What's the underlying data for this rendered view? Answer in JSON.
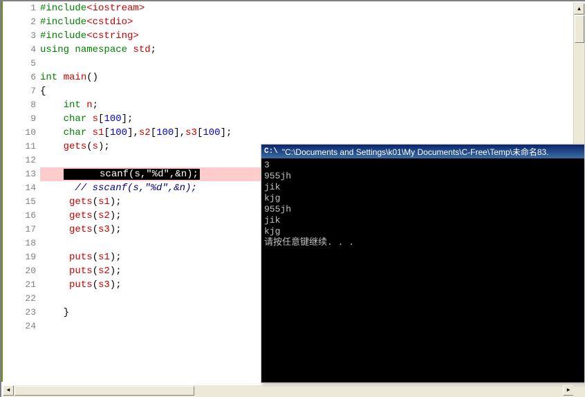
{
  "editor": {
    "lines": [
      {
        "num": "1",
        "segs": [
          {
            "cls": "kw-green",
            "t": "#include"
          },
          {
            "cls": "kw-red",
            "t": "<iostream>"
          }
        ]
      },
      {
        "num": "2",
        "segs": [
          {
            "cls": "kw-green",
            "t": "#include"
          },
          {
            "cls": "kw-red",
            "t": "<cstdio>"
          }
        ]
      },
      {
        "num": "3",
        "segs": [
          {
            "cls": "kw-green",
            "t": "#include"
          },
          {
            "cls": "kw-red",
            "t": "<cstring>"
          }
        ]
      },
      {
        "num": "4",
        "segs": [
          {
            "cls": "kw-green",
            "t": "using"
          },
          {
            "cls": "text-black",
            "t": " "
          },
          {
            "cls": "kw-green",
            "t": "namespace"
          },
          {
            "cls": "text-black",
            "t": " "
          },
          {
            "cls": "kw-red",
            "t": "std"
          },
          {
            "cls": "text-black",
            "t": ";"
          }
        ]
      },
      {
        "num": "5",
        "segs": []
      },
      {
        "num": "6",
        "segs": [
          {
            "cls": "kw-green",
            "t": "int"
          },
          {
            "cls": "text-black",
            "t": " "
          },
          {
            "cls": "kw-red",
            "t": "main"
          },
          {
            "cls": "text-black",
            "t": "()"
          }
        ]
      },
      {
        "num": "7",
        "segs": [
          {
            "cls": "text-black",
            "t": "{"
          }
        ]
      },
      {
        "num": "8",
        "segs": [
          {
            "cls": "text-black",
            "t": "    "
          },
          {
            "cls": "kw-green",
            "t": "int"
          },
          {
            "cls": "text-black",
            "t": " "
          },
          {
            "cls": "kw-red",
            "t": "n"
          },
          {
            "cls": "text-black",
            "t": ";"
          }
        ]
      },
      {
        "num": "9",
        "segs": [
          {
            "cls": "text-black",
            "t": "    "
          },
          {
            "cls": "kw-green",
            "t": "char"
          },
          {
            "cls": "text-black",
            "t": " "
          },
          {
            "cls": "kw-red",
            "t": "s"
          },
          {
            "cls": "text-black",
            "t": "["
          },
          {
            "cls": "lit-blue",
            "t": "100"
          },
          {
            "cls": "text-black",
            "t": "];"
          }
        ]
      },
      {
        "num": "10",
        "segs": [
          {
            "cls": "text-black",
            "t": "    "
          },
          {
            "cls": "kw-green",
            "t": "char"
          },
          {
            "cls": "text-black",
            "t": " "
          },
          {
            "cls": "kw-red",
            "t": "s1"
          },
          {
            "cls": "text-black",
            "t": "["
          },
          {
            "cls": "lit-blue",
            "t": "100"
          },
          {
            "cls": "text-black",
            "t": "],"
          },
          {
            "cls": "kw-red",
            "t": "s2"
          },
          {
            "cls": "text-black",
            "t": "["
          },
          {
            "cls": "lit-blue",
            "t": "100"
          },
          {
            "cls": "text-black",
            "t": "],"
          },
          {
            "cls": "kw-red",
            "t": "s3"
          },
          {
            "cls": "text-black",
            "t": "["
          },
          {
            "cls": "lit-blue",
            "t": "100"
          },
          {
            "cls": "text-black",
            "t": "];"
          }
        ]
      },
      {
        "num": "11",
        "segs": [
          {
            "cls": "text-black",
            "t": "    "
          },
          {
            "cls": "kw-red",
            "t": "gets"
          },
          {
            "cls": "text-black",
            "t": "("
          },
          {
            "cls": "kw-red",
            "t": "s"
          },
          {
            "cls": "text-black",
            "t": ");"
          }
        ]
      },
      {
        "num": "12",
        "segs": []
      },
      {
        "num": "13",
        "breakpoint": true,
        "highlight": true,
        "current": true,
        "segs": [
          {
            "cls": "text-black",
            "t": "      "
          },
          {
            "cls": "kw-red",
            "t": "scanf"
          },
          {
            "cls": "text-black",
            "t": "("
          },
          {
            "cls": "kw-red",
            "t": "s"
          },
          {
            "cls": "text-black",
            "t": ","
          },
          {
            "cls": "lit-orange",
            "t": "\"%d\""
          },
          {
            "cls": "text-black",
            "t": ",&"
          },
          {
            "cls": "kw-red",
            "t": "n"
          },
          {
            "cls": "text-black",
            "t": ");"
          }
        ]
      },
      {
        "num": "14",
        "segs": [
          {
            "cls": "text-black",
            "t": "      "
          },
          {
            "cls": "comment-navy",
            "t": "// sscanf(s,\"%d\",&n);"
          }
        ]
      },
      {
        "num": "15",
        "segs": [
          {
            "cls": "text-black",
            "t": "     "
          },
          {
            "cls": "kw-red",
            "t": "gets"
          },
          {
            "cls": "text-black",
            "t": "("
          },
          {
            "cls": "kw-red",
            "t": "s1"
          },
          {
            "cls": "text-black",
            "t": ");"
          }
        ]
      },
      {
        "num": "16",
        "segs": [
          {
            "cls": "text-black",
            "t": "     "
          },
          {
            "cls": "kw-red",
            "t": "gets"
          },
          {
            "cls": "text-black",
            "t": "("
          },
          {
            "cls": "kw-red",
            "t": "s2"
          },
          {
            "cls": "text-black",
            "t": ");"
          }
        ]
      },
      {
        "num": "17",
        "segs": [
          {
            "cls": "text-black",
            "t": "     "
          },
          {
            "cls": "kw-red",
            "t": "gets"
          },
          {
            "cls": "text-black",
            "t": "("
          },
          {
            "cls": "kw-red",
            "t": "s3"
          },
          {
            "cls": "text-black",
            "t": ");"
          }
        ]
      },
      {
        "num": "18",
        "segs": []
      },
      {
        "num": "19",
        "segs": [
          {
            "cls": "text-black",
            "t": "     "
          },
          {
            "cls": "kw-red",
            "t": "puts"
          },
          {
            "cls": "text-black",
            "t": "("
          },
          {
            "cls": "kw-red",
            "t": "s1"
          },
          {
            "cls": "text-black",
            "t": ");"
          }
        ]
      },
      {
        "num": "20",
        "segs": [
          {
            "cls": "text-black",
            "t": "     "
          },
          {
            "cls": "kw-red",
            "t": "puts"
          },
          {
            "cls": "text-black",
            "t": "("
          },
          {
            "cls": "kw-red",
            "t": "s2"
          },
          {
            "cls": "text-black",
            "t": ");"
          }
        ]
      },
      {
        "num": "21",
        "segs": [
          {
            "cls": "text-black",
            "t": "     "
          },
          {
            "cls": "kw-red",
            "t": "puts"
          },
          {
            "cls": "text-black",
            "t": "("
          },
          {
            "cls": "kw-red",
            "t": "s3"
          },
          {
            "cls": "text-black",
            "t": ");"
          }
        ]
      },
      {
        "num": "22",
        "segs": []
      },
      {
        "num": "23",
        "segs": [
          {
            "cls": "text-black",
            "t": "    }"
          }
        ]
      },
      {
        "num": "24",
        "segs": []
      }
    ]
  },
  "console": {
    "title_prefix": "C:\\",
    "title": "\"C:\\Documents and Settings\\k01\\My Documents\\C-Free\\Temp\\未命名83.",
    "output": [
      "3",
      "955jh",
      "jik",
      "kjg",
      "955jh",
      "jik",
      "kjg",
      "请按任意键继续. . ."
    ]
  },
  "scroll": {
    "up": "▲",
    "down": "▼",
    "left": "◄",
    "right": "►"
  }
}
